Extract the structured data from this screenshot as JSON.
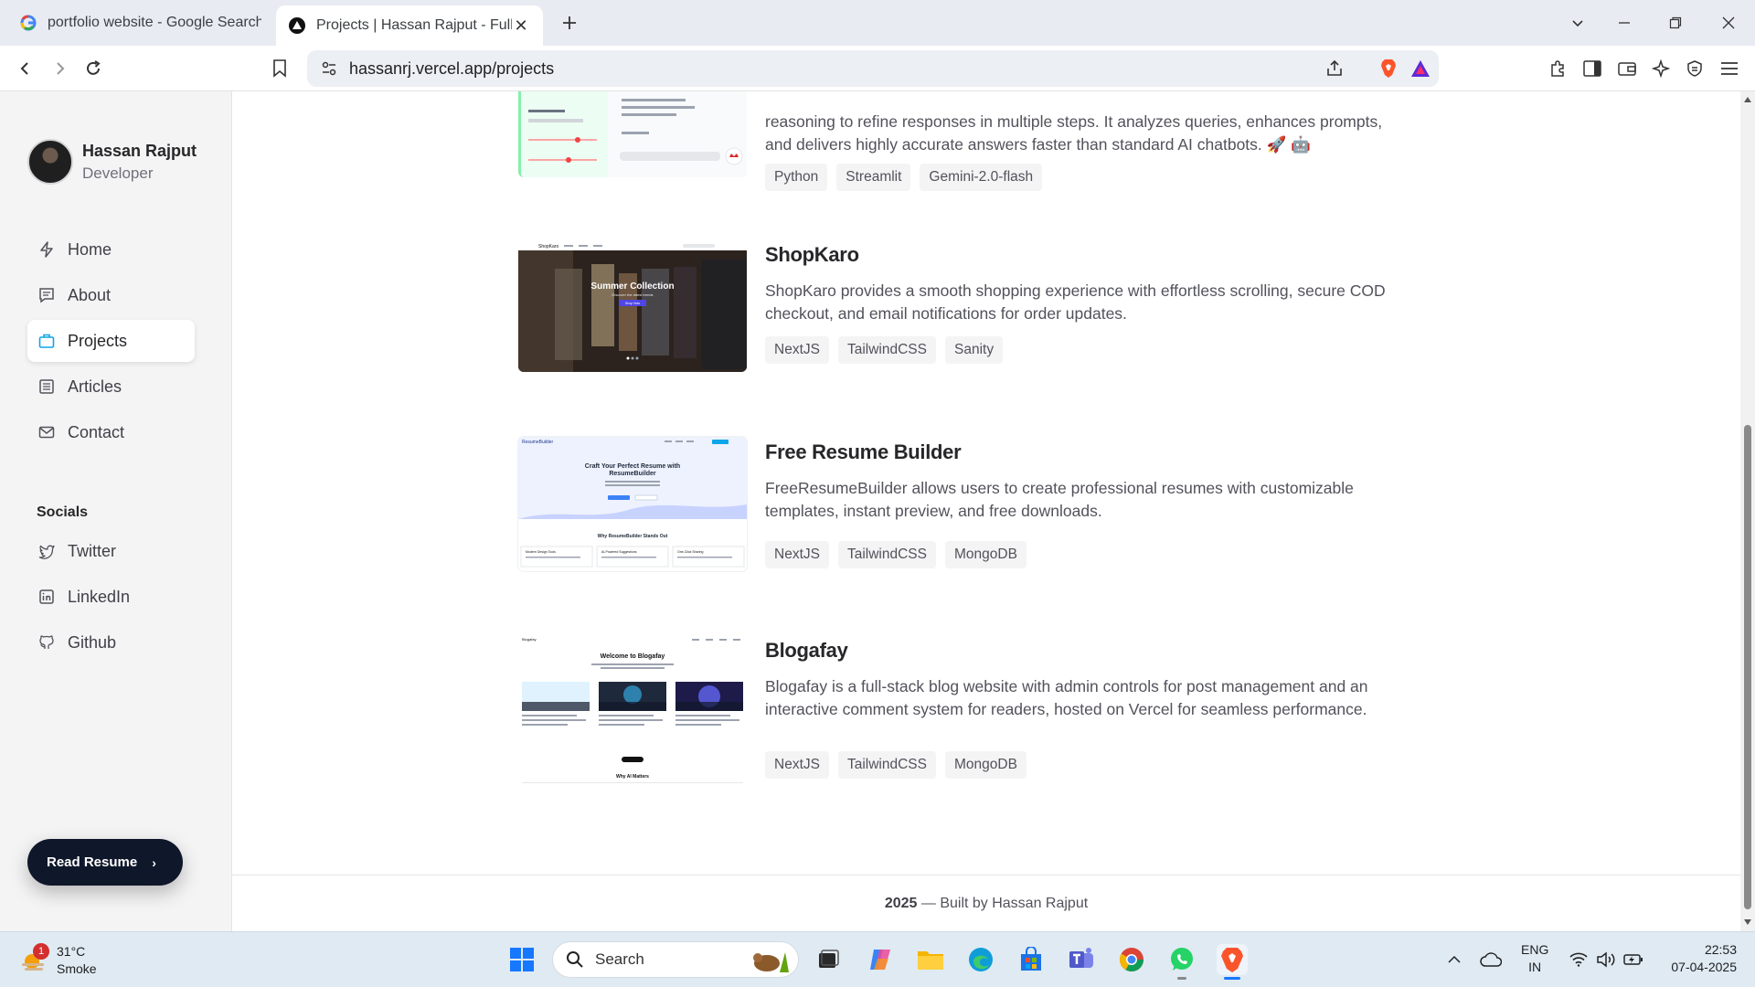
{
  "browser": {
    "tabs": [
      {
        "title": "portfolio website - Google Search",
        "active": false
      },
      {
        "title": "Projects | Hassan Rajput - Full Stack",
        "active": true
      }
    ],
    "url": "hassanrj.vercel.app/projects"
  },
  "sidebar": {
    "name": "Hassan Rajput",
    "role": "Developer",
    "nav": [
      {
        "label": "Home",
        "icon": "bolt-icon"
      },
      {
        "label": "About",
        "icon": "message-icon"
      },
      {
        "label": "Projects",
        "icon": "briefcase-icon",
        "active": true
      },
      {
        "label": "Articles",
        "icon": "document-icon"
      },
      {
        "label": "Contact",
        "icon": "mail-icon"
      }
    ],
    "socials_heading": "Socials",
    "socials": [
      {
        "label": "Twitter",
        "icon": "twitter-icon"
      },
      {
        "label": "LinkedIn",
        "icon": "linkedin-icon"
      },
      {
        "label": "Github",
        "icon": "github-icon"
      }
    ],
    "resume_button": "Read Resume"
  },
  "projects": [
    {
      "title": "",
      "description_line_1": "reasoning to refine responses in multiple steps. It analyzes queries, enhances prompts,",
      "description_line_2": "and delivers highly accurate answers faster than standard AI chatbots. 🚀 🤖",
      "tags": [
        "Python",
        "Streamlit",
        "Gemini-2.0-flash"
      ]
    },
    {
      "title": "ShopKaro",
      "description": "ShopKaro provides a smooth shopping experience with effortless scrolling, secure COD checkout, and email notifications for order updates.",
      "tags": [
        "NextJS",
        "TailwindCSS",
        "Sanity"
      ],
      "thumb_text": {
        "logo": "ShopKaro",
        "headline": "Summer Collection",
        "sub": "Discover the latest trends",
        "cta": "Shop Now"
      }
    },
    {
      "title": "Free Resume Builder",
      "description": "FreeResumeBuilder allows users to create professional resumes with customizable templates, instant preview, and free downloads.",
      "tags": [
        "NextJS",
        "TailwindCSS",
        "MongoDB"
      ],
      "thumb_text": {
        "logo": "ResumeBuilder",
        "headline_1": "Craft Your Perfect Resume with",
        "headline_2": "ResumeBuilder",
        "section": "Why ResumeBuilder Stands Out",
        "f1": "Modern Design Tools",
        "f2": "AI-Powered Suggestions",
        "f3": "One-Click Sharing"
      }
    },
    {
      "title": "Blogafay",
      "description": "Blogafay is a full-stack blog website with admin controls for post management and an interactive comment system for readers, hosted on Vercel for seamless performance.",
      "tags": [
        "NextJS",
        "TailwindCSS",
        "MongoDB"
      ],
      "thumb_text": {
        "logo": "Blogafay",
        "headline": "Welcome to Blogafay",
        "section": "Why AI Matters"
      }
    }
  ],
  "footer": {
    "year": "2025",
    "text": " — Built by Hassan Rajput"
  },
  "taskbar": {
    "weather_temp": "31°C",
    "weather_desc": "Smoke",
    "weather_badge": "1",
    "search_placeholder": "Search",
    "lang_1": "ENG",
    "lang_2": "IN",
    "time": "22:53",
    "date": "07-04-2025"
  },
  "colors": {
    "accent_blue": "#0ea5e9",
    "dark_button": "#0f172a",
    "sidebar_bg": "#f4f4f5"
  }
}
